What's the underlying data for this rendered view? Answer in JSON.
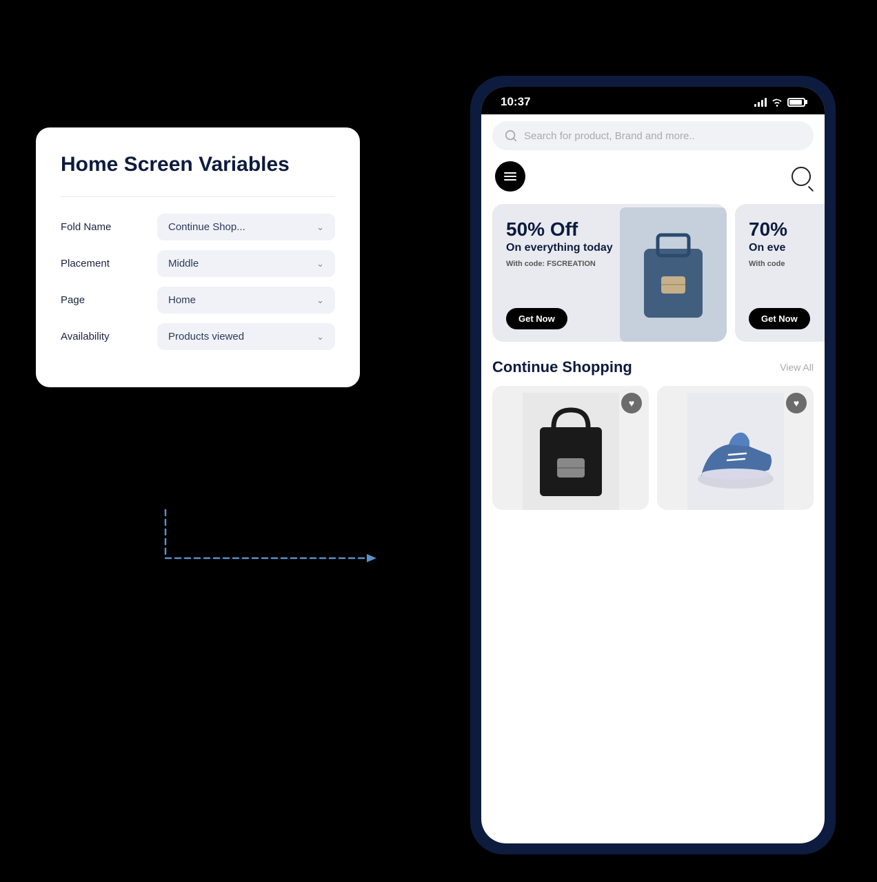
{
  "card": {
    "title": "Home Screen Variables",
    "divider": true,
    "rows": [
      {
        "id": "fold-name",
        "label": "Fold Name",
        "value": "Continue Shop...",
        "has_chevron": true
      },
      {
        "id": "placement",
        "label": "Placement",
        "value": "Middle",
        "has_chevron": true
      },
      {
        "id": "page",
        "label": "Page",
        "value": "Home",
        "has_chevron": true
      },
      {
        "id": "availability",
        "label": "Availability",
        "value": "Products viewed",
        "has_chevron": true
      }
    ]
  },
  "phone": {
    "status_bar": {
      "time": "10:37",
      "signal_label": "signal",
      "wifi_label": "wifi",
      "battery_label": "battery"
    },
    "search": {
      "placeholder": "Search for product, Brand and more.."
    },
    "banner": {
      "discount": "50% Off",
      "subtitle": "On everything today",
      "code": "With code: FSCREATION",
      "button": "Get Now",
      "discount2": "70%",
      "subtitle2": "On eve",
      "code2": "With code",
      "button2": "Get Now"
    },
    "continue_section": {
      "title": "Continue Shopping",
      "view_all": "View All"
    }
  },
  "icons": {
    "chevron": "∨",
    "heart": "♥",
    "search": "○"
  }
}
